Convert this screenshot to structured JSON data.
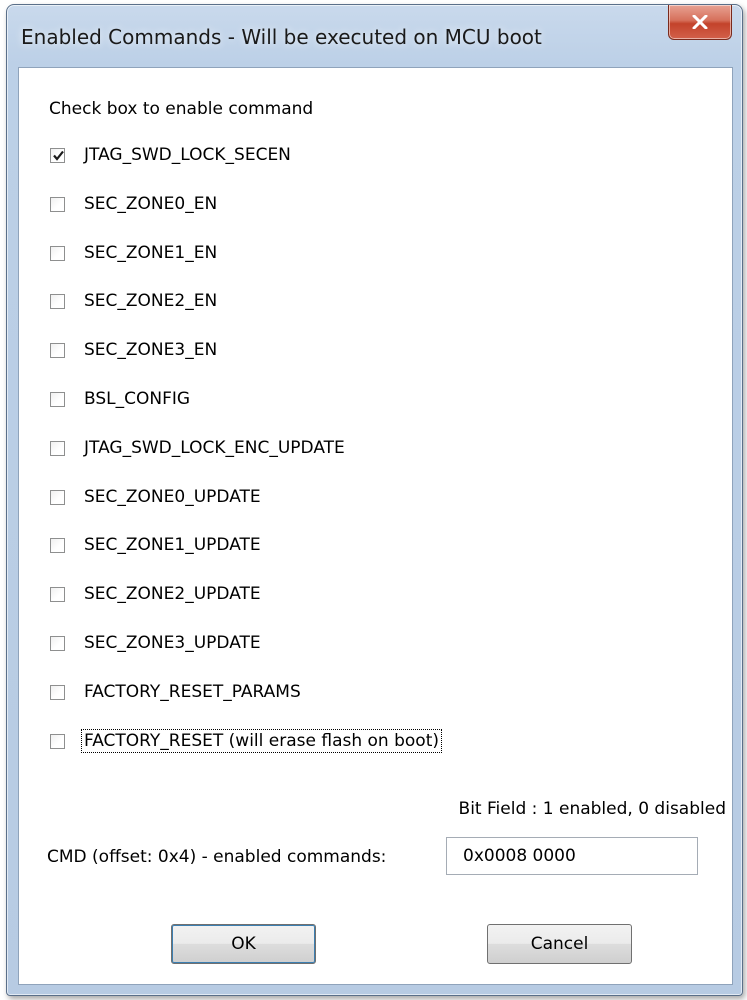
{
  "window": {
    "title": "Enabled Commands - Will be executed on MCU boot",
    "close_icon": "close-icon"
  },
  "instruction": "Check box to enable command",
  "commands": [
    {
      "label": "JTAG_SWD_LOCK_SECEN",
      "checked": true
    },
    {
      "label": "SEC_ZONE0_EN",
      "checked": false
    },
    {
      "label": "SEC_ZONE1_EN",
      "checked": false
    },
    {
      "label": "SEC_ZONE2_EN",
      "checked": false
    },
    {
      "label": "SEC_ZONE3_EN",
      "checked": false
    },
    {
      "label": "BSL_CONFIG",
      "checked": false
    },
    {
      "label": "JTAG_SWD_LOCK_ENC_UPDATE",
      "checked": false
    },
    {
      "label": "SEC_ZONE0_UPDATE",
      "checked": false
    },
    {
      "label": "SEC_ZONE1_UPDATE",
      "checked": false
    },
    {
      "label": "SEC_ZONE2_UPDATE",
      "checked": false
    },
    {
      "label": "SEC_ZONE3_UPDATE",
      "checked": false
    },
    {
      "label": "FACTORY_RESET_PARAMS",
      "checked": false
    },
    {
      "label": "FACTORY_RESET  (will erase flash on boot)",
      "checked": false,
      "focused": true
    }
  ],
  "bit_field_note": "Bit Field : 1 enabled, 0 disabled",
  "cmd_field": {
    "label": "CMD (offset: 0x4) - enabled commands:",
    "value": "0x0008 0000"
  },
  "buttons": {
    "ok_label": "OK",
    "cancel_label": "Cancel"
  },
  "colors": {
    "title_bar": "#bcd0e7",
    "close_button": "#c3432b",
    "default_button_border": "#3c7fb1"
  }
}
